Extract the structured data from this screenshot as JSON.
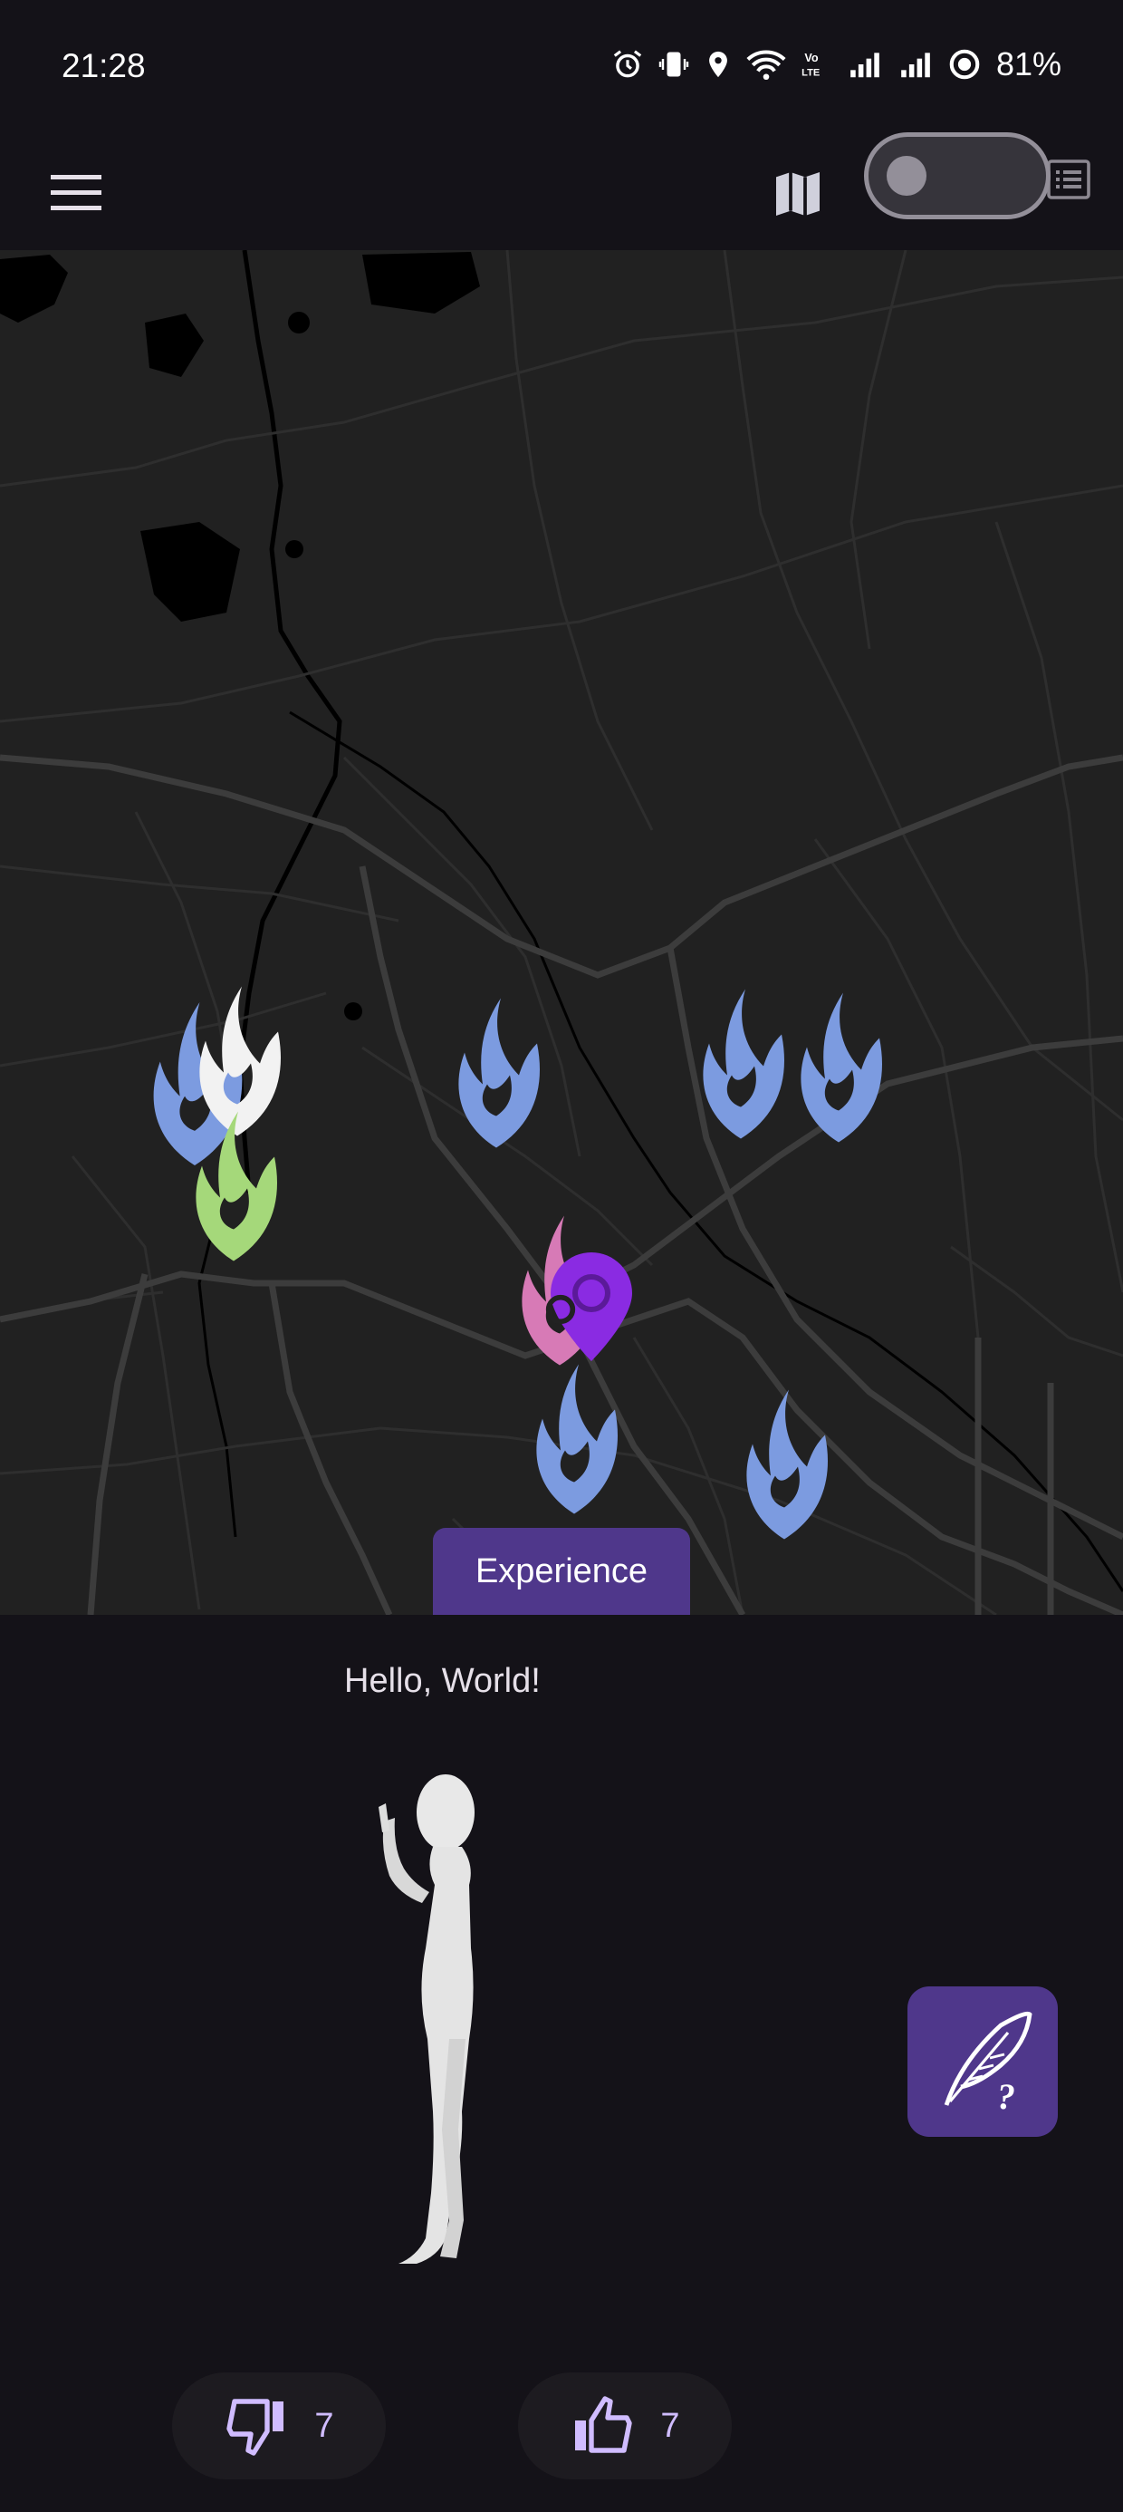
{
  "status_bar": {
    "time": "21:28",
    "battery": "81%",
    "icons": [
      "alarm-icon",
      "vibrate-icon",
      "location-icon",
      "wifi-icon",
      "volte-icon",
      "signal-icon",
      "signal-icon",
      "battery-ring-icon"
    ]
  },
  "app_bar": {
    "menu_icon": "hamburger-menu-icon",
    "map_icon": "map-icon",
    "toggle_state": "off",
    "list_icon": "list-view-icon"
  },
  "map": {
    "tab_label": "Experience",
    "markers": [
      {
        "kind": "flame",
        "color": "#7c9be0"
      },
      {
        "kind": "flame",
        "color": "#f2f2f2"
      },
      {
        "kind": "flame",
        "color": "#a5d87a"
      },
      {
        "kind": "flame",
        "color": "#7c9be0"
      },
      {
        "kind": "flame",
        "color": "#7c9be0"
      },
      {
        "kind": "flame",
        "color": "#7c9be0"
      },
      {
        "kind": "flame",
        "color": "#d77ab6"
      },
      {
        "kind": "pin",
        "color": "#8a2be2"
      },
      {
        "kind": "flame",
        "color": "#7c9be0"
      },
      {
        "kind": "flame",
        "color": "#7c9be0"
      }
    ]
  },
  "content": {
    "greeting": "Hello, World!",
    "figure": "3d-human-figure"
  },
  "fab": {
    "icon": "quill-question-icon",
    "color": "#4f378b"
  },
  "votes": {
    "dislike_count": "7",
    "like_count": "7",
    "accent": "#d0bcff"
  },
  "colors": {
    "background": "#141218",
    "map_background": "#212121",
    "primary_container": "#4f378b"
  }
}
